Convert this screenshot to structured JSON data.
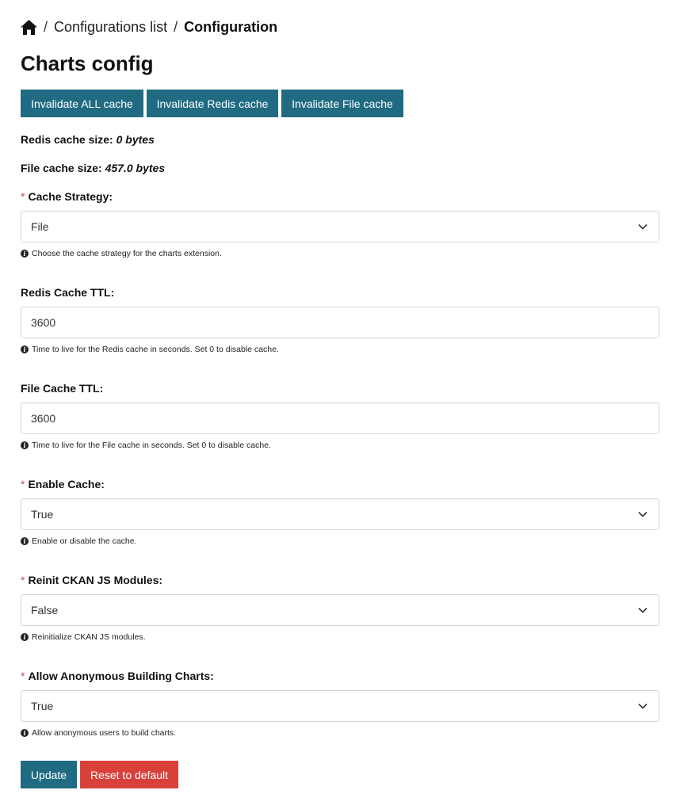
{
  "breadcrumb": {
    "items": [
      "Configurations list"
    ],
    "current": "Configuration",
    "separator": "/"
  },
  "page_title": "Charts config",
  "cache_buttons": {
    "invalidate_all": "Invalidate ALL cache",
    "invalidate_redis": "Invalidate Redis cache",
    "invalidate_file": "Invalidate File cache"
  },
  "cache_info": {
    "redis_label": "Redis cache size:",
    "redis_value": "0 bytes",
    "file_label": "File cache size:",
    "file_value": "457.0 bytes"
  },
  "fields": {
    "cache_strategy": {
      "label": "Cache Strategy:",
      "required": "*",
      "value": "File",
      "help": "Choose the cache strategy for the charts extension."
    },
    "redis_ttl": {
      "label": "Redis Cache TTL:",
      "value": "3600",
      "help": "Time to live for the Redis cache in seconds. Set 0 to disable cache."
    },
    "file_ttl": {
      "label": "File Cache TTL:",
      "value": "3600",
      "help": "Time to live for the File cache in seconds. Set 0 to disable cache."
    },
    "enable_cache": {
      "label": "Enable Cache:",
      "required": "*",
      "value": "True",
      "help": "Enable or disable the cache."
    },
    "reinit_modules": {
      "label": "Reinit CKAN JS Modules:",
      "required": "*",
      "value": "False",
      "help": "Reinitialize CKAN JS modules."
    },
    "allow_anonymous": {
      "label": "Allow Anonymous Building Charts:",
      "required": "*",
      "value": "True",
      "help": "Allow anonymous users to build charts."
    }
  },
  "actions": {
    "update": "Update",
    "reset": "Reset to default"
  },
  "colors": {
    "primary": "#206b82",
    "danger": "#d9403a",
    "required_mark": "#c94a4a"
  },
  "icons": {
    "home": "home-icon",
    "info": "info-icon",
    "chevron": "chevron-down-icon"
  }
}
